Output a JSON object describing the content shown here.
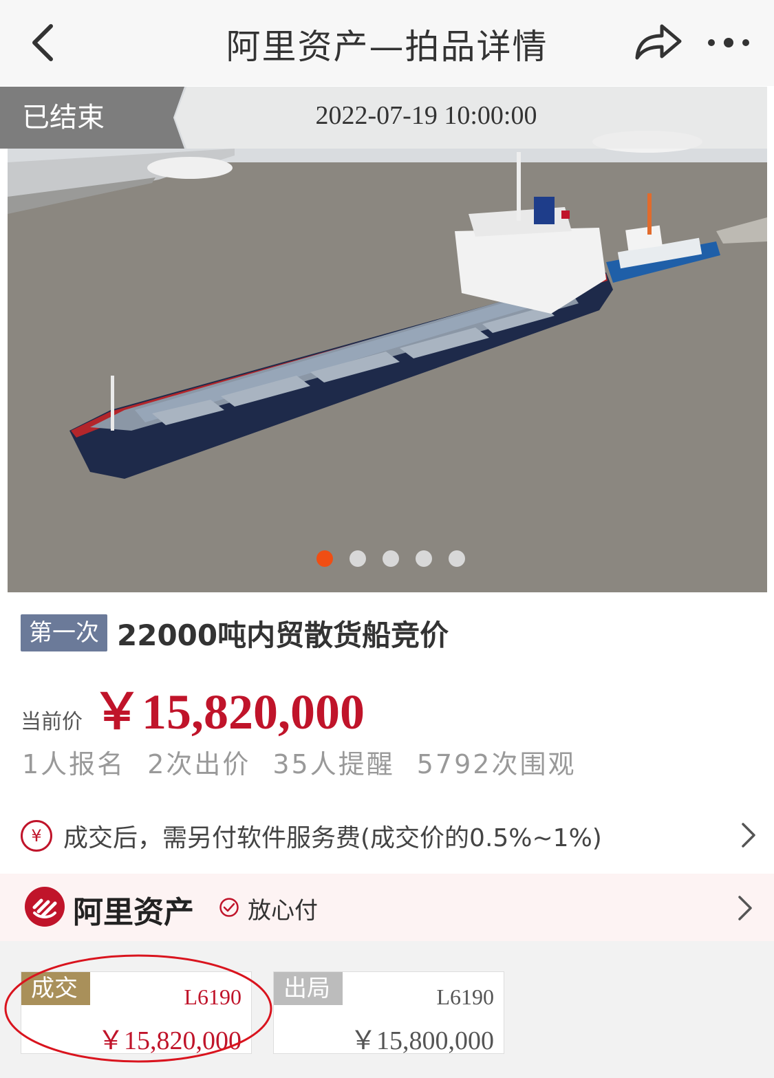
{
  "header": {
    "title": "阿里资产—拍品详情",
    "back_icon": "chevron-left-icon",
    "share_icon": "share-icon",
    "more_icon": "more-dots-icon"
  },
  "status": {
    "label": "已结束",
    "time": "2022-07-19 10:00:00"
  },
  "carousel": {
    "image": "cargo-ship-photo",
    "total": 5,
    "active_index": 0
  },
  "item": {
    "round_tag": "第一次",
    "title": "22000吨内贸散货船竞价"
  },
  "price": {
    "label": "当前价",
    "value": "￥15,820,000"
  },
  "stats": [
    "1人报名",
    "2次出价",
    "35人提醒",
    "5792次围观"
  ],
  "fee": {
    "icon_text": "¥",
    "text": "成交后，需另付软件服务费(成交价的0.5%~1%)"
  },
  "brand": {
    "name": "阿里资产",
    "safe_text": "放心付"
  },
  "bids": [
    {
      "tag": "成交",
      "code": "L6190",
      "amount": "￥15,820,000"
    },
    {
      "tag": "出局",
      "code": "L6190",
      "amount": "￥15,800,000"
    }
  ],
  "colors": {
    "accent": "#c0142a",
    "dot_active": "#f04e13",
    "tag_blue": "#6b7a99",
    "tag_gold": "#a9905a"
  }
}
